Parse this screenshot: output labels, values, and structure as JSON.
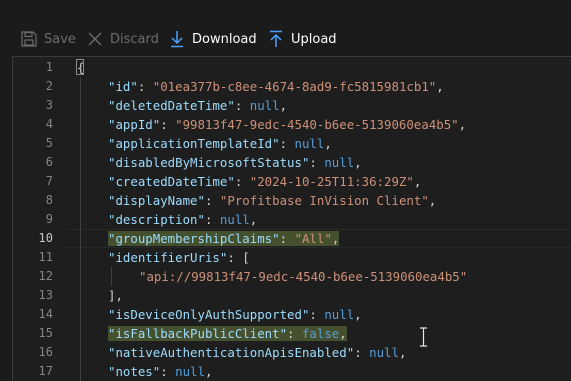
{
  "toolbar": {
    "save_label": "Save",
    "discard_label": "Discard",
    "download_label": "Download",
    "upload_label": "Upload"
  },
  "editor": {
    "active_line": 10,
    "line_numbers": [
      "1",
      "2",
      "3",
      "4",
      "5",
      "6",
      "7",
      "8",
      "9",
      "10",
      "11",
      "12",
      "13",
      "14",
      "15",
      "16",
      "17"
    ],
    "lines": [
      {
        "indent": 0,
        "tokens": [
          {
            "t": "p",
            "v": "{"
          }
        ]
      },
      {
        "indent": 1,
        "tokens": [
          {
            "t": "k",
            "v": "\"id\""
          },
          {
            "t": "p",
            "v": ": "
          },
          {
            "t": "s",
            "v": "\"01ea377b-c8ee-4674-8ad9-fc5815981cb1\""
          },
          {
            "t": "p",
            "v": ","
          }
        ]
      },
      {
        "indent": 1,
        "tokens": [
          {
            "t": "k",
            "v": "\"deletedDateTime\""
          },
          {
            "t": "p",
            "v": ": "
          },
          {
            "t": "n",
            "v": "null"
          },
          {
            "t": "p",
            "v": ","
          }
        ]
      },
      {
        "indent": 1,
        "tokens": [
          {
            "t": "k",
            "v": "\"appId\""
          },
          {
            "t": "p",
            "v": ": "
          },
          {
            "t": "s",
            "v": "\"99813f47-9edc-4540-b6ee-5139060ea4b5\""
          },
          {
            "t": "p",
            "v": ","
          }
        ]
      },
      {
        "indent": 1,
        "tokens": [
          {
            "t": "k",
            "v": "\"applicationTemplateId\""
          },
          {
            "t": "p",
            "v": ": "
          },
          {
            "t": "n",
            "v": "null"
          },
          {
            "t": "p",
            "v": ","
          }
        ]
      },
      {
        "indent": 1,
        "tokens": [
          {
            "t": "k",
            "v": "\"disabledByMicrosoftStatus\""
          },
          {
            "t": "p",
            "v": ": "
          },
          {
            "t": "n",
            "v": "null"
          },
          {
            "t": "p",
            "v": ","
          }
        ]
      },
      {
        "indent": 1,
        "tokens": [
          {
            "t": "k",
            "v": "\"createdDateTime\""
          },
          {
            "t": "p",
            "v": ": "
          },
          {
            "t": "s",
            "v": "\"2024-10-25T11:36:29Z\""
          },
          {
            "t": "p",
            "v": ","
          }
        ]
      },
      {
        "indent": 1,
        "tokens": [
          {
            "t": "k",
            "v": "\"displayName\""
          },
          {
            "t": "p",
            "v": ": "
          },
          {
            "t": "s",
            "v": "\"Profitbase InVision Client\""
          },
          {
            "t": "p",
            "v": ","
          }
        ]
      },
      {
        "indent": 1,
        "tokens": [
          {
            "t": "k",
            "v": "\"description\""
          },
          {
            "t": "p",
            "v": ": "
          },
          {
            "t": "n",
            "v": "null"
          },
          {
            "t": "p",
            "v": ","
          }
        ]
      },
      {
        "indent": 1,
        "highlight": true,
        "tokens": [
          {
            "t": "k",
            "v": "\"groupMembershipClaims\""
          },
          {
            "t": "p",
            "v": ": "
          },
          {
            "t": "s",
            "v": "\"All\""
          },
          {
            "t": "p",
            "v": ","
          }
        ]
      },
      {
        "indent": 1,
        "tokens": [
          {
            "t": "k",
            "v": "\"identifierUris\""
          },
          {
            "t": "p",
            "v": ": ["
          }
        ]
      },
      {
        "indent": 2,
        "tokens": [
          {
            "t": "s",
            "v": "\"api://99813f47-9edc-4540-b6ee-5139060ea4b5\""
          }
        ]
      },
      {
        "indent": 1,
        "tokens": [
          {
            "t": "p",
            "v": "],"
          }
        ]
      },
      {
        "indent": 1,
        "tokens": [
          {
            "t": "k",
            "v": "\"isDeviceOnlyAuthSupported\""
          },
          {
            "t": "p",
            "v": ": "
          },
          {
            "t": "n",
            "v": "null"
          },
          {
            "t": "p",
            "v": ","
          }
        ]
      },
      {
        "indent": 1,
        "highlight": true,
        "tokens": [
          {
            "t": "k",
            "v": "\"isFallbackPublicClient\""
          },
          {
            "t": "p",
            "v": ": "
          },
          {
            "t": "n",
            "v": "false"
          },
          {
            "t": "p",
            "v": ","
          }
        ]
      },
      {
        "indent": 1,
        "tokens": [
          {
            "t": "k",
            "v": "\"nativeAuthenticationApisEnabled\""
          },
          {
            "t": "p",
            "v": ": "
          },
          {
            "t": "n",
            "v": "null"
          },
          {
            "t": "p",
            "v": ","
          }
        ]
      },
      {
        "indent": 1,
        "tokens": [
          {
            "t": "k",
            "v": "\"notes\""
          },
          {
            "t": "p",
            "v": ": "
          },
          {
            "t": "n",
            "v": "null"
          },
          {
            "t": "p",
            "v": ","
          }
        ]
      }
    ]
  },
  "colors": {
    "key": "#9cdcfe",
    "string": "#ce9178",
    "literal": "#569cd6",
    "punctuation": "#d4d4d4",
    "highlight": "#3e4a22",
    "toolbar_disabled": "#6d6d6d",
    "toolbar_enabled": "#ffffff",
    "accent": "#4aa3ff"
  }
}
